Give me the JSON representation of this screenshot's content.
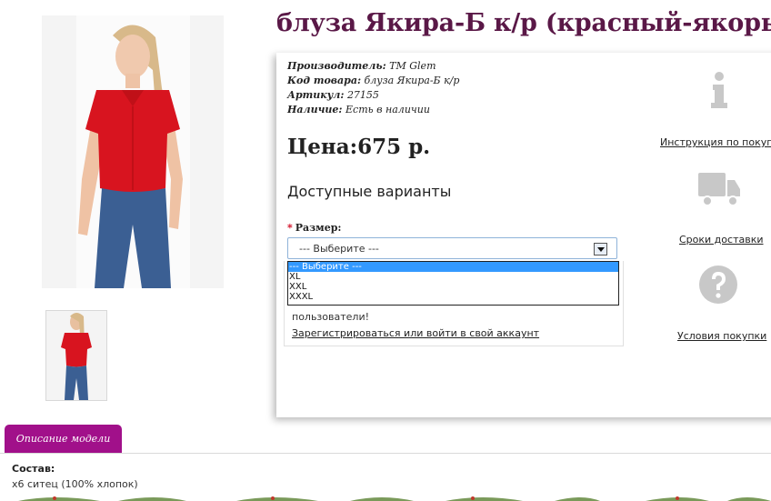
{
  "product": {
    "title": "блуза Якира-Б к/р (красный-якорь)",
    "manufacturer_label": "Производитель:",
    "manufacturer_value": "ТМ Glem",
    "code_label": "Код товара:",
    "code_value": "блуза Якира-Б к/р",
    "article_label": "Артикул:",
    "article_value": "27155",
    "availability_label": "Наличие:",
    "availability_value": "Есть в наличии",
    "price": "Цена:675 р."
  },
  "variants": {
    "title": "Доступные варианты",
    "required_mark": "*",
    "size_label": "Размер:",
    "selected": "--- Выберите ---",
    "options": [
      "--- Выберите ---",
      "XL",
      "XXL",
      "XXXL"
    ]
  },
  "notice": {
    "text": "пользователи!",
    "link": "Зарегистрироваться или войти в свой аккаунт"
  },
  "sidebar": {
    "links": [
      {
        "label": "Инструкция по покупке",
        "icon": "info-icon"
      },
      {
        "label": "Сроки доставки",
        "icon": "truck-icon"
      },
      {
        "label": "Условия покупки",
        "icon": "question-icon"
      }
    ]
  },
  "tabs": {
    "description": "Описание модели"
  },
  "description": {
    "composition_label": "Состав:",
    "composition_value": "х6 ситец (100% хлопок)"
  },
  "colors": {
    "title": "#5a1847",
    "tab": "#a1108a",
    "blouse": "#d8141f",
    "jeans": "#3b5f93",
    "icon_gray": "#c8c8c8"
  }
}
